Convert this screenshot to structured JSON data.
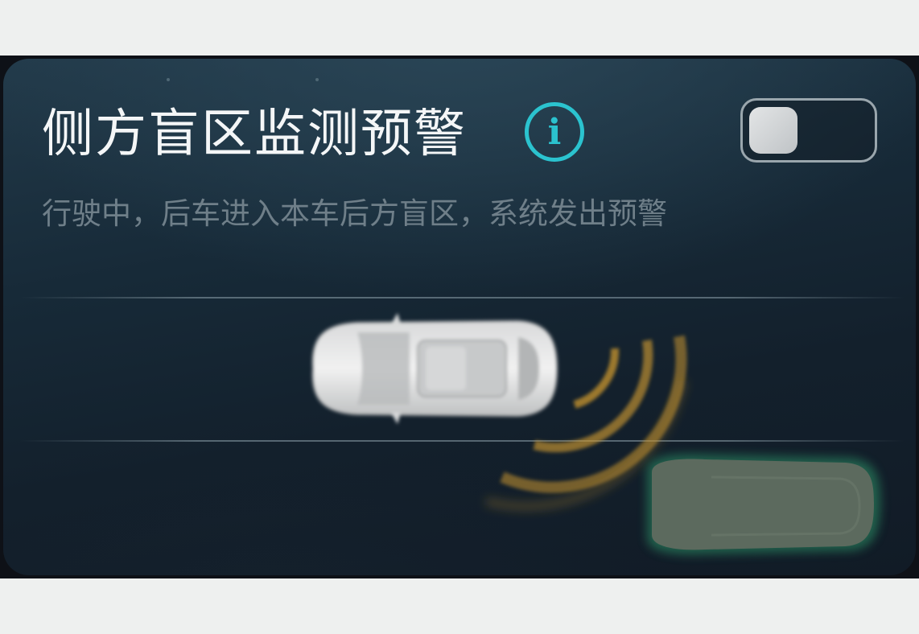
{
  "feature": {
    "title": "侧方盲区监测预警",
    "description": "行驶中，后车进入本车后方盲区，系统发出预警",
    "info_icon": "info-circle-icon",
    "info_glyph": "i",
    "toggle_enabled": false
  },
  "colors": {
    "accent": "#2bc3cf",
    "warning_wave": "#d9a23a",
    "rear_vehicle": "#5c6a5e",
    "rear_vehicle_glow": "#2f9a6a"
  }
}
